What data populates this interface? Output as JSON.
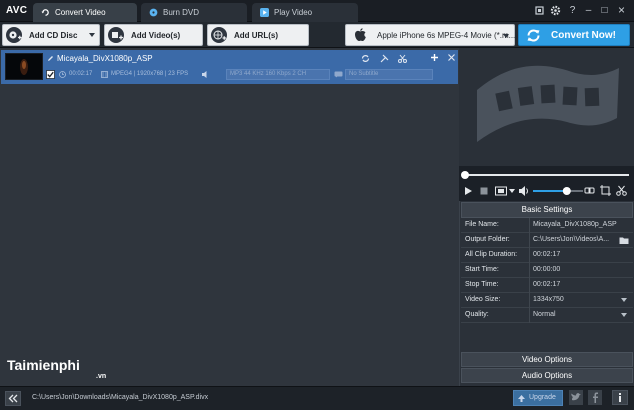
{
  "app": {
    "logo": "AVC"
  },
  "tabs": [
    {
      "label": "Convert Video",
      "active": true
    },
    {
      "label": "Burn DVD",
      "active": false
    },
    {
      "label": "Play Video",
      "active": false
    }
  ],
  "window_controls": {
    "minimize": "–",
    "restore": "□",
    "close": "×",
    "help": "?"
  },
  "toolbar": {
    "add_cd_label": "Add CD Disc",
    "add_video_label": "Add Video(s)",
    "add_url_label": "Add URL(s)",
    "profile_label": "Apple iPhone 6s MPEG-4 Movie (*.m...",
    "convert_label": "Convert Now!"
  },
  "file": {
    "name": "Micayala_DivX1080p_ASP",
    "duration": "00:02:17",
    "video_info": "MPEG4 | 1920x768 | 23 FPS",
    "audio_info": "MP3 44 KHz 160 Kbps 2 CH",
    "subtitle": "No Subtitle",
    "checked": true
  },
  "settings": {
    "header": "Basic Settings",
    "rows": [
      {
        "key": "File Name:",
        "value": "Micayala_DivX1080p_ASP"
      },
      {
        "key": "Output Folder:",
        "value": "C:\\Users\\Jon\\Videos\\A..."
      },
      {
        "key": "All Clip Duration:",
        "value": "00:02:17"
      },
      {
        "key": "Start Time:",
        "value": "00:00:00"
      },
      {
        "key": "Stop Time:",
        "value": "00:02:17"
      },
      {
        "key": "Video Size:",
        "value": "1334x750"
      },
      {
        "key": "Quality:",
        "value": "Normal"
      }
    ],
    "video_options": "Video Options",
    "audio_options": "Audio Options"
  },
  "player": {
    "seek_position": 0.0,
    "volume_level": 0.7
  },
  "status": {
    "path": "C:\\Users\\Jon\\Downloads\\Micayala_DivX1080p_ASP.divx",
    "upgrade_label": "Upgrade"
  },
  "watermark": {
    "main": "Taimienphi",
    "sub": ".vn"
  },
  "colors": {
    "accent": "#2e9fe5",
    "selected_row": "#3b6aa8",
    "background": "#2f353d"
  }
}
